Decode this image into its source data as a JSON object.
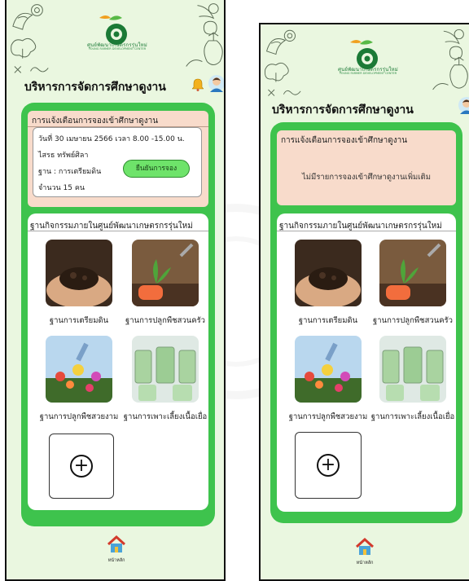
{
  "logo": {
    "center_name": "ศูนย์พัฒนาเกษตรกรรุ่นใหม่",
    "center_name_en": "YOUNG FARMER DEVELOPMENT CENTER"
  },
  "header": {
    "title": "บริหารการจัดการศึกษาดูงาน"
  },
  "icons": {
    "notification": "bell-icon",
    "profile": "user-avatar-icon",
    "add": "plus-circle-icon",
    "home": "home-icon"
  },
  "colors": {
    "background": "#eaf7e0",
    "card": "#3ec34d",
    "notice": "#f8dbcb",
    "button": "#6ee36a"
  },
  "screen_a": {
    "notice_title": "การแจ้งเตือนการจองเข้าศึกษาดูงาน",
    "booking": {
      "date_time": "วันที่ 30 เมษายน 2566  เวลา 8.00 -15.00 น.",
      "name": "ไสรธ ทรัพย์ศิลา",
      "station": "ฐาน : การเตรียมดิน",
      "count": "จำนวน 15 คน",
      "confirm_label": "ยืนยันการจอง"
    }
  },
  "screen_b": {
    "notice_title": "การแจ้งเตือนการจองเข้าศึกษาดูงาน",
    "empty_message": "ไม่มีรายการจองเข้าศึกษาดูงานเพิ่มเติม"
  },
  "activities": {
    "title": "ฐานกิจกรรมภายในศูนย์พัฒนาเกษตรกรรุ่นใหม่",
    "items": [
      {
        "label": "ฐานการเตรียมดิน"
      },
      {
        "label": "ฐานการปลูกพืชสวนครัว"
      },
      {
        "label": "ฐานการปลูกพืชสวยงาม"
      },
      {
        "label": "ฐานการเพาะเลี้ยงเนื้อเยื่อ"
      }
    ]
  },
  "nav": {
    "home_label": "หน้าหลัก"
  }
}
